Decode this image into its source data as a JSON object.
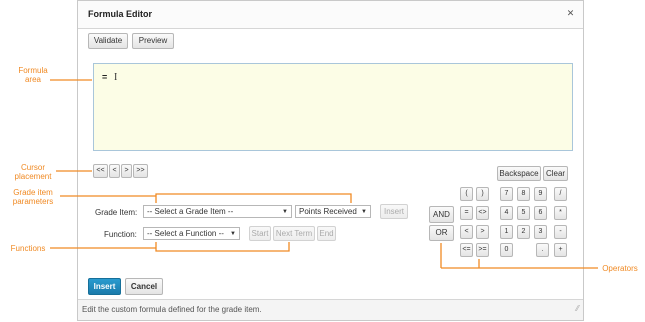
{
  "dialog": {
    "title": "Formula Editor",
    "close_icon": "close-icon",
    "toolbar": {
      "validate": "Validate",
      "preview": "Preview"
    },
    "formula": {
      "value": "="
    },
    "cursor_buttons": [
      "<<",
      "<",
      ">",
      ">>"
    ],
    "grade_item": {
      "label": "Grade Item:",
      "select_value": "-- Select a Grade Item --",
      "points_value": "Points Received",
      "insert_label": "Insert"
    },
    "function": {
      "label": "Function:",
      "select_value": "-- Select a Function --",
      "start_label": "Start",
      "next_term_label": "Next Term",
      "end_label": "End"
    },
    "operators": {
      "backspace": "Backspace",
      "clear": "Clear",
      "and": "AND",
      "or": "OR",
      "symbols": [
        [
          "(",
          ")"
        ],
        [
          "=",
          "<>"
        ],
        [
          "<",
          ">"
        ],
        [
          "<=",
          ">="
        ]
      ],
      "numpad": [
        [
          "7",
          "8",
          "9",
          "/"
        ],
        [
          "4",
          "5",
          "6",
          "*"
        ],
        [
          "1",
          "2",
          "3",
          "-"
        ],
        [
          "0",
          "",
          ".",
          "+"
        ]
      ]
    },
    "footer": {
      "insert": "Insert",
      "cancel": "Cancel"
    },
    "status": "Edit the custom formula defined for the grade item."
  },
  "annotations": {
    "formula_area": [
      "Formula",
      "area"
    ],
    "cursor_placement": [
      "Cursor",
      "placement"
    ],
    "grade_item_parameters": [
      "Grade item",
      "parameters"
    ],
    "functions": "Functions",
    "operators": "Operators"
  },
  "colors": {
    "accent": "#f08a24",
    "primary": "#1f88bb",
    "formula_bg": "#fcfde6"
  }
}
